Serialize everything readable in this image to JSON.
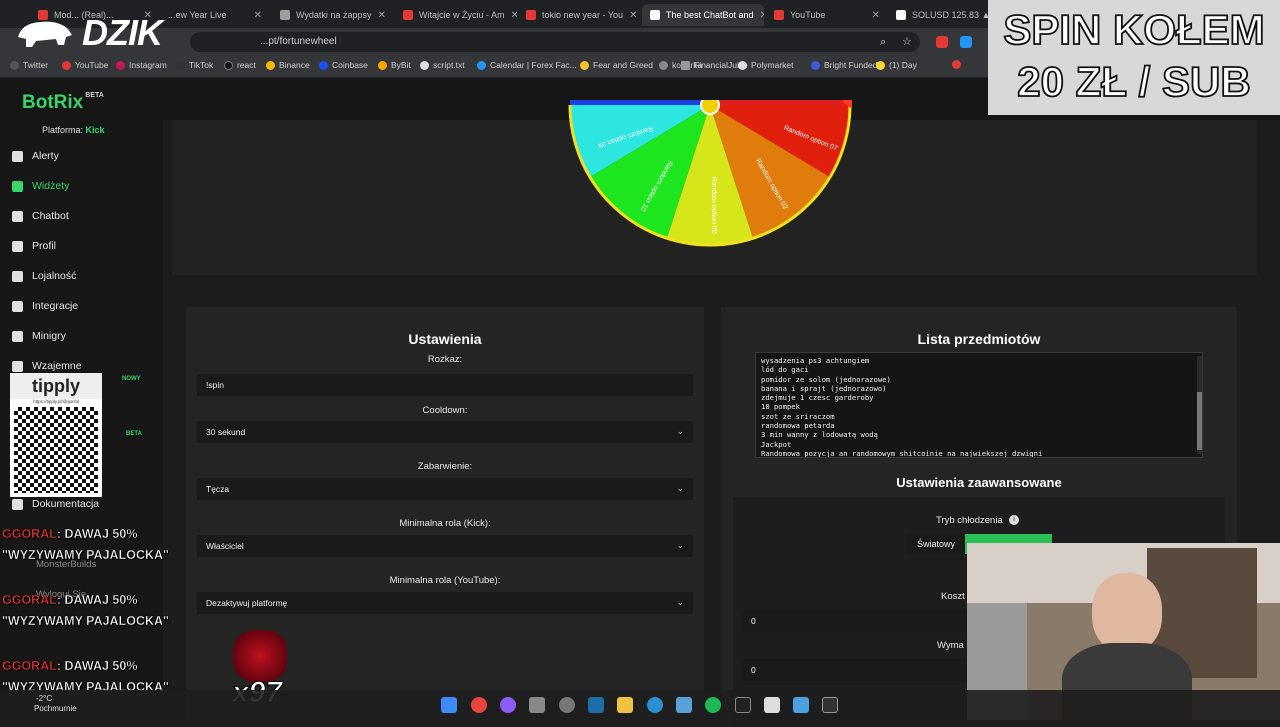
{
  "browser": {
    "tabs": [
      {
        "label": "Mod... (Real)...",
        "color": "#e53935"
      },
      {
        "label": "...ew Year Live",
        "color": "#e53935"
      },
      {
        "label": "Wydatki na żappsy",
        "color": "#9e9e9e"
      },
      {
        "label": "Witajcie w Życiu - Am",
        "color": "#e53935"
      },
      {
        "label": "tokio new year - You",
        "color": "#e53935"
      },
      {
        "label": "The best ChatBot and",
        "color": "#ffffff"
      },
      {
        "label": "YouTube",
        "color": "#e53935"
      },
      {
        "label": "SOLUSD 125.83 ▲",
        "color": "#ffffff"
      }
    ],
    "url": "...pt/fortunewheel",
    "bookmarks": [
      "Twitter",
      "YouTube",
      "Instagram",
      "TikTok",
      "react",
      "Binance",
      "Coinbase",
      "ByBit",
      "script.txt",
      "Calendar | Forex Fac...",
      "Fear and Greed",
      "koparka",
      "FinancialJuice",
      "Polymarket",
      "Bright Funded",
      "(1) Day"
    ]
  },
  "app": {
    "logo": "BotRix",
    "logo_badge": "BETA",
    "platform_label": "Platforma:",
    "platform_value": "Kick"
  },
  "sidebar": {
    "items": [
      {
        "label": "Alerty",
        "icon": "bell-icon"
      },
      {
        "label": "Widżety",
        "icon": "grid-icon"
      },
      {
        "label": "Chatbot",
        "icon": "robot-icon"
      },
      {
        "label": "Profil",
        "icon": "profile-icon"
      },
      {
        "label": "Lojalność",
        "icon": "trophy-icon"
      },
      {
        "label": "Integracje",
        "icon": "plug-icon"
      },
      {
        "label": "Minigry",
        "icon": "gamepad-icon"
      },
      {
        "label": "Wzajemne",
        "icon": "music-icon"
      },
      {
        "label": "Dokumentacja",
        "icon": "book-icon"
      }
    ],
    "badge_new": "NOWY",
    "badge_beta": "BETA",
    "extra_items": [
      "MonsterBuilds",
      "Wyloguj Się"
    ]
  },
  "wheel": {
    "segments": [
      {
        "label": "Random option 09",
        "color": "#2ee6e0"
      },
      {
        "label": "Random option 10",
        "color": "#1ee61e"
      },
      {
        "label": "Random option 00",
        "color": "#d6e61a"
      },
      {
        "label": "Random option 02",
        "color": "#e07c0c"
      },
      {
        "label": "Random option 07",
        "color": "#e0200c"
      }
    ]
  },
  "settings": {
    "title": "Ustawienia",
    "command_label": "Rozkaz:",
    "command_value": "!spin",
    "cooldown_label": "Cooldown:",
    "cooldown_value": "30 sekund",
    "color_label": "Zabarwienie:",
    "color_value": "Tęcza",
    "minrole_kick_label": "Minimalna rola (Kick):",
    "minrole_kick_value": "Właściciel",
    "minrole_yt_label": "Minimalna rola (YouTube):",
    "minrole_yt_value": "Dezaktywuj platformę"
  },
  "items": {
    "title": "Lista przedmiotów",
    "lines": [
      "wysadzenia ps3 achtungiem",
      "lód do gaci",
      "pomidor ze solom (jednorazowe)",
      "banana i sprajt (jednorazowo)",
      "zdejmuje 1 czesc garderoby",
      "10 pompek",
      "szot ze sriraczom",
      "randomowa petarda",
      "3 min wanny z lodowatą wodą",
      "Jackpot",
      "Randomowa pozycja an randomowym shitcoinie na najwiekszej dzwigni"
    ]
  },
  "advanced": {
    "title": "Ustawienia zaawansowane",
    "cooldown_mode_label": "Tryb chłodzenia",
    "mode_global": "Światowy",
    "cost_label": "Koszt",
    "cost_value": "0",
    "required_label": "Wyma",
    "required_value": "0"
  },
  "overlay": {
    "brand": "DZIK",
    "spin_line1": "SPIN KOŁEM",
    "spin_line2": "20 ZŁ / SUB",
    "tipply": "tipply",
    "tipply_url": "https://tipply.pl/@gorral",
    "chat": [
      {
        "nick": "GGORAL",
        "text": ": DAWAJ 50%",
        "text2": "\"WYZYWAMY PAJALOCKA\""
      },
      {
        "nick": "GGORAL",
        "text": ": DAWAJ 50%",
        "text2": "\"WYZYWAMY PAJALOCKA\""
      },
      {
        "nick": "GGORAL",
        "text": ": DAWAJ 50%",
        "text2": "\"WYZYWAMY PAJALOCKA\""
      }
    ],
    "combo": "x97",
    "weather_temp": "-2°C",
    "weather_desc": "Pochmurnie"
  }
}
